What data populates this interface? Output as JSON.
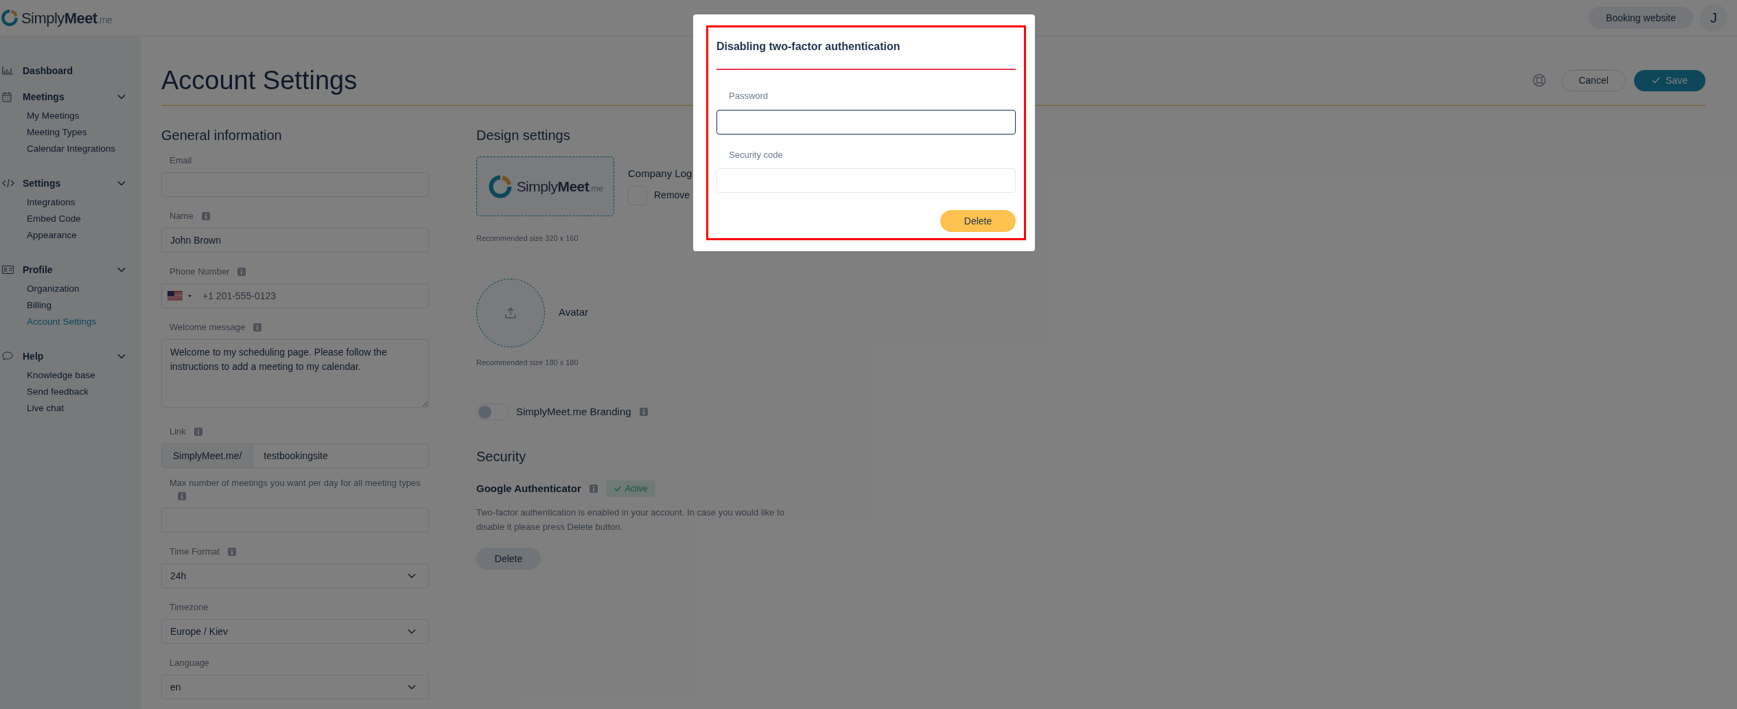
{
  "header": {
    "logo": {
      "light": "Simply",
      "bold": "Meet",
      "suffix": ".me"
    },
    "booking_button": "Booking website",
    "avatar": "J"
  },
  "sidebar": {
    "items": [
      {
        "kind": "link",
        "label": "Dashboard"
      },
      {
        "kind": "group",
        "label": "Meetings",
        "expanded": true,
        "children": [
          {
            "label": "My Meetings",
            "selected": false
          },
          {
            "label": "Meeting Types",
            "selected": false
          },
          {
            "label": "Calendar Integrations",
            "selected": false
          }
        ]
      },
      {
        "kind": "group",
        "label": "Settings",
        "expanded": true,
        "children": [
          {
            "label": "Integrations",
            "selected": false
          },
          {
            "label": "Embed Code",
            "selected": false
          },
          {
            "label": "Appearance",
            "selected": false
          }
        ]
      },
      {
        "kind": "group",
        "label": "Profile",
        "expanded": true,
        "children": [
          {
            "label": "Organization",
            "selected": false
          },
          {
            "label": "Billing",
            "selected": false
          },
          {
            "label": "Account Settings",
            "selected": true
          }
        ]
      },
      {
        "kind": "group",
        "label": "Help",
        "expanded": true,
        "children": [
          {
            "label": "Knowledge base",
            "selected": false
          },
          {
            "label": "Send feedback",
            "selected": false
          },
          {
            "label": "Live chat",
            "selected": false
          }
        ]
      }
    ]
  },
  "page": {
    "title": "Account Settings",
    "cancel": "Cancel",
    "save": "Save"
  },
  "general": {
    "title": "General information",
    "fields": [
      {
        "kind": "text",
        "label": "Email",
        "info": false
      },
      {
        "kind": "text",
        "label": "Name",
        "info": true,
        "value": "John Brown"
      },
      {
        "kind": "phone",
        "label": "Phone Number",
        "info": true,
        "value": "+1 201-555-0123"
      },
      {
        "kind": "textarea",
        "label": "Welcome message",
        "info": true,
        "value": "Welcome to my scheduling page. Please follow the instructions to add a meeting to my calendar."
      },
      {
        "kind": "link",
        "label": "Link",
        "info": true,
        "prefix": "SimplyMeet.me/",
        "value": "testbookingsite"
      },
      {
        "kind": "text",
        "label": "Max number of meetings you want per day for all meeting types",
        "info": true
      },
      {
        "kind": "select",
        "label": "Time Format",
        "info": true,
        "value": "24h"
      },
      {
        "kind": "select",
        "label": "Timezone",
        "info": false,
        "value": "Europe / Kiev"
      },
      {
        "kind": "select",
        "label": "Language",
        "info": false,
        "value": "en"
      }
    ]
  },
  "design": {
    "title": "Design settings",
    "logo_image": {
      "light": "Simply",
      "bold": "Meet",
      "suffix": ".me"
    },
    "logo_label": "Company Log",
    "remove_label": "Remove",
    "remove_checked": false,
    "logo_hint": "Recommended size 320 x 160",
    "avatar_label": "Avatar",
    "avatar_hint": "Recommended size 180 x 180",
    "branding": {
      "label": "SimplyMeet.me Branding",
      "on": false
    }
  },
  "security": {
    "title": "Security",
    "method": "Google Authenticator",
    "status": "Active",
    "description": "Two-factor authentication is enabled in your account. In case you would like to disable it please press Delete button.",
    "delete": "Delete"
  },
  "modal": {
    "title": "Disabling two-factor authentication",
    "fields": [
      {
        "label": "Password",
        "focused": true
      },
      {
        "label": "Security code",
        "focused": false
      }
    ],
    "button": "Delete"
  }
}
